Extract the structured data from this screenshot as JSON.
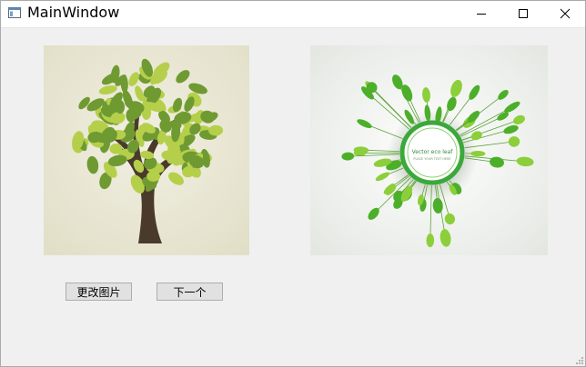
{
  "window": {
    "title": "MainWindow",
    "controls": [
      "minimize-icon",
      "maximize-icon",
      "close-icon"
    ]
  },
  "images": {
    "left": {
      "icon": "tree-illustration"
    },
    "right": {
      "icon": "vector-eco-leaf-ring",
      "caption": "Vector eco leaf",
      "subcaption": "PLACE YOUR TEXT HERE"
    }
  },
  "buttons": {
    "change_image": "更改图片",
    "next": "下一个"
  },
  "colors": {
    "tree_bg": "#e9e6d4",
    "trunk": "#4a3a2c",
    "leaf_light": "#b5cf4b",
    "leaf_dark": "#6f9a32",
    "ring": "#3aa83a"
  }
}
